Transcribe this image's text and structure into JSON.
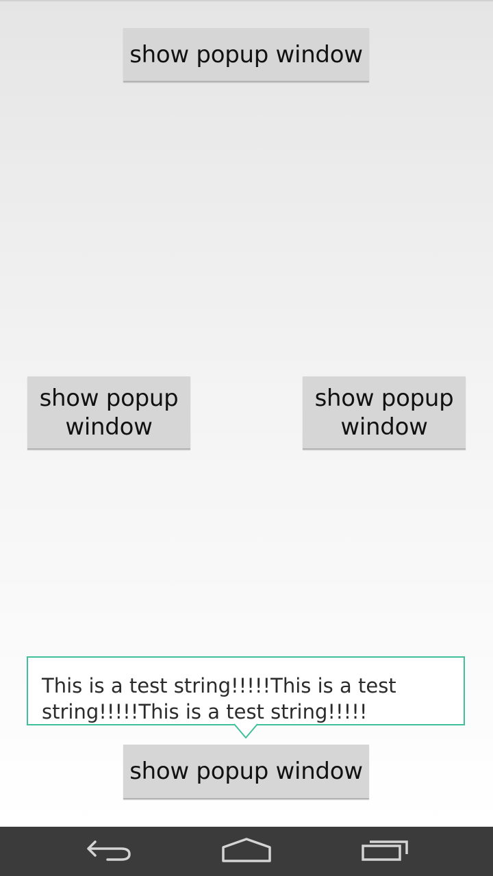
{
  "buttons": {
    "top": "show popup window",
    "left": "show popup\nwindow",
    "right": "show popup\nwindow",
    "bottom": "show popup window"
  },
  "popup": {
    "text": "This is a test string!!!!!This is a test string!!!!!This is a test string!!!!!"
  },
  "colors": {
    "popup_border": "#3fbf9a",
    "button_bg": "#d6d6d6",
    "navbar_bg": "#3b3b3b"
  },
  "navbar": {
    "icons": [
      "back-icon",
      "home-icon",
      "recents-icon"
    ]
  }
}
